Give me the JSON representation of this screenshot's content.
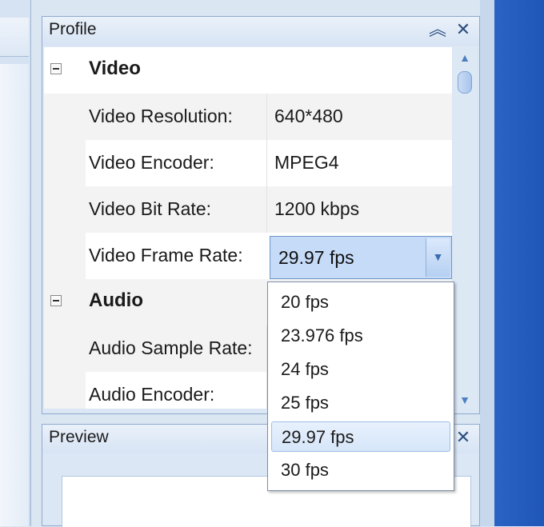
{
  "profile_panel": {
    "title": "Profile",
    "pin_icon": "︽",
    "close_icon": "✕"
  },
  "categories": {
    "video": "Video",
    "audio": "Audio"
  },
  "video_properties": [
    {
      "name": "Video Resolution:",
      "value": "640*480"
    },
    {
      "name": "Video Encoder:",
      "value": "MPEG4"
    },
    {
      "name": "Video Bit Rate:",
      "value": "1200 kbps"
    },
    {
      "name": "Video Frame Rate:",
      "value": "29.97 fps"
    }
  ],
  "audio_properties": [
    {
      "name": "Audio Sample Rate:",
      "value": ""
    },
    {
      "name": "Audio Encoder:",
      "value": ""
    }
  ],
  "frame_rate_combo": {
    "selected": "29.97 fps",
    "options": [
      "20 fps",
      "23.976 fps",
      "24 fps",
      "25 fps",
      "29.97 fps",
      "30 fps"
    ]
  },
  "preview_panel": {
    "title": "Preview",
    "close_icon": "✕"
  },
  "colors": {
    "accent": "#c5dbf7",
    "panel_border": "#8fa9cc",
    "desktop_blue": "#1f56b8"
  }
}
